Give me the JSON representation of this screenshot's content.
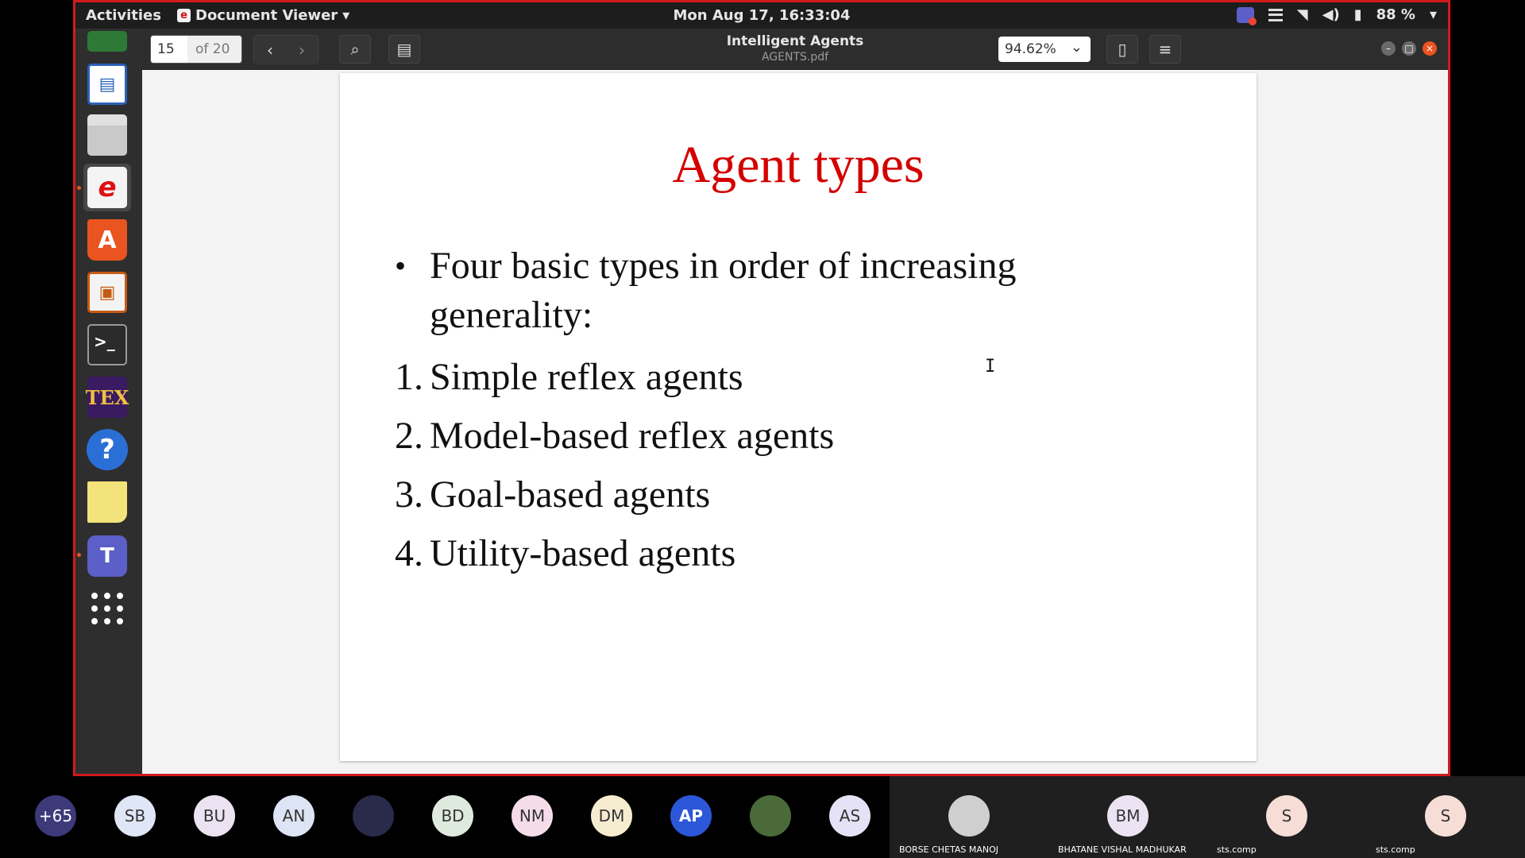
{
  "topbar": {
    "activities": "Activities",
    "app_name": "Document Viewer",
    "clock": "Mon Aug 17, 16:33:04",
    "battery": "88 %"
  },
  "dock": {
    "items": [
      "libreoffice-calc-icon",
      "libreoffice-writer-icon",
      "files-icon",
      "document-viewer-icon",
      "ubuntu-software-icon",
      "libreoffice-impress-icon",
      "terminal-icon",
      "texmaker-icon",
      "help-icon",
      "sticky-notes-icon",
      "microsoft-teams-icon",
      "show-applications-icon"
    ],
    "tex_label": "TEX",
    "terminal_prompt": ">_",
    "help_glyph": "?",
    "teams_glyph": "T"
  },
  "viewer": {
    "current_page": "15",
    "page_total": "of 20",
    "title": "Intelligent Agents",
    "filename": "AGENTS.pdf",
    "zoom": "94.62%"
  },
  "slide": {
    "title": "Agent types",
    "bullet": "Four basic types in order of increasing generality:",
    "items": [
      {
        "num": "1.",
        "text": "Simple reflex agents"
      },
      {
        "num": "2.",
        "text": "Model-based reflex agents"
      },
      {
        "num": "3.",
        "text": "Goal-based agents"
      },
      {
        "num": "4.",
        "text": "Utility-based agents"
      }
    ]
  },
  "participants": {
    "overflow": "+65",
    "avatars": [
      {
        "initials": "SB",
        "color": "#dfe6f5"
      },
      {
        "initials": "BU",
        "color": "#ebe3f2"
      },
      {
        "initials": "AN",
        "color": "#dde4f3"
      },
      {
        "initials": "",
        "color": "#2a2a4a"
      },
      {
        "initials": "BD",
        "color": "#dfeadf"
      },
      {
        "initials": "NM",
        "color": "#f4dde8"
      },
      {
        "initials": "DM",
        "color": "#f6ecd0"
      },
      {
        "initials": "AP",
        "color": "#2b57d8"
      },
      {
        "initials": "",
        "color": "#4a6a3a"
      },
      {
        "initials": "AS",
        "color": "#e4e2f4"
      }
    ],
    "tiles": [
      {
        "initials": "",
        "name": "BORSE CHETAS MANOJ",
        "color": "#cfcfcf"
      },
      {
        "initials": "BM",
        "name": "BHATANE VISHAL MADHUKAR",
        "color": "#ebe3f2"
      },
      {
        "initials": "S",
        "name": "sts.comp",
        "color": "#f6ddd6"
      },
      {
        "initials": "S",
        "name": "sts.comp",
        "color": "#f6ddd6"
      }
    ]
  }
}
